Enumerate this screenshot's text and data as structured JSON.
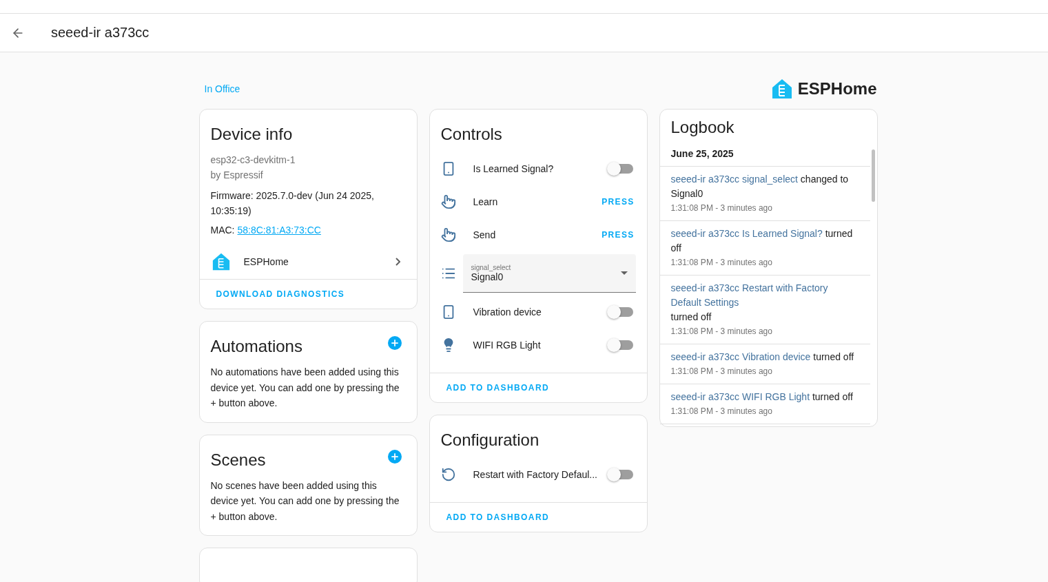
{
  "header": {
    "title": "seeed-ir a373cc"
  },
  "area": "In Office",
  "brand": "ESPHome",
  "device_info": {
    "title": "Device info",
    "model": "esp32-c3-devkitm-1",
    "manufacturer": "by Espressif",
    "firmware": "Firmware: 2025.7.0-dev (Jun 24 2025, 10:35:19)",
    "mac_label": "MAC:",
    "mac": "58:8C:81:A3:73:CC",
    "integration": "ESPHome",
    "action": "DOWNLOAD DIAGNOSTICS"
  },
  "automations": {
    "title": "Automations",
    "text": "No automations have been added using this device yet. You can add one by pressing the + button above."
  },
  "scenes": {
    "title": "Scenes",
    "text": "No scenes have been added using this device yet. You can add one by pressing the + button above."
  },
  "controls": {
    "title": "Controls",
    "action": "ADD TO DASHBOARD",
    "items": [
      {
        "kind": "toggle",
        "name": "Is Learned Signal?",
        "on": false
      },
      {
        "kind": "button",
        "name": "Learn",
        "action": "PRESS"
      },
      {
        "kind": "button",
        "name": "Send",
        "action": "PRESS"
      },
      {
        "kind": "select",
        "label": "signal_select",
        "value": "Signal0"
      },
      {
        "kind": "toggle",
        "name": "Vibration device",
        "on": false
      },
      {
        "kind": "toggle",
        "name": "WIFI RGB Light",
        "on": false
      }
    ]
  },
  "configuration": {
    "title": "Configuration",
    "action": "ADD TO DASHBOARD",
    "items": [
      {
        "kind": "toggle",
        "name": "Restart with Factory Defaul...",
        "on": false
      }
    ]
  },
  "logbook": {
    "title": "Logbook",
    "date": "June 25, 2025",
    "entries": [
      {
        "entity": "seeed-ir a373cc signal_select",
        "message": "changed to Signal0",
        "time": "1:31:08 PM - 3 minutes ago"
      },
      {
        "entity": "seeed-ir a373cc Is Learned Signal?",
        "message": "turned off",
        "time": "1:31:08 PM - 3 minutes ago"
      },
      {
        "entity": "seeed-ir a373cc Restart with Factory Default Settings",
        "message": "turned off",
        "time": "1:31:08 PM - 3 minutes ago"
      },
      {
        "entity": "seeed-ir a373cc Vibration device",
        "message": "turned off",
        "time": "1:31:08 PM - 3 minutes ago"
      },
      {
        "entity": "seeed-ir a373cc WIFI RGB Light",
        "message": "turned off",
        "time": "1:31:08 PM - 3 minutes ago"
      }
    ]
  }
}
